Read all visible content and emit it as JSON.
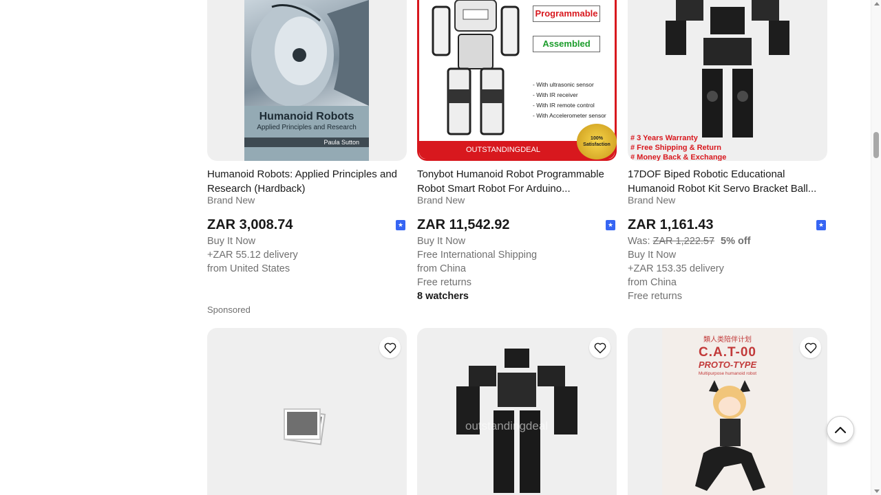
{
  "colors": {
    "text_primary": "#191919",
    "text_secondary": "#707070",
    "accent_blue": "#3665f3",
    "brand_red": "#d8181e"
  },
  "listings_row1": [
    {
      "title": "Humanoid Robots: Applied Principles and Research (Hardback)",
      "condition": "Brand New",
      "price": "ZAR 3,008.74",
      "buy_format": "Buy It Now",
      "shipping": "+ZAR 55.12 delivery",
      "location": "from United States",
      "image": {
        "book_title": "Humanoid Robots",
        "book_subtitle": "Applied Principles and Research",
        "book_author": "Paula Sutton"
      }
    },
    {
      "title": "Tonybot Humanoid Robot Programmable Robot Smart Robot For Arduino...",
      "condition": "Brand New",
      "price": "ZAR 11,542.92",
      "buy_format": "Buy It Now",
      "shipping": "Free International Shipping",
      "location": "from China",
      "returns": "Free returns",
      "watchers": "8 watchers",
      "image": {
        "tag_programmable": "Programmable",
        "tag_assembled": "Assembled",
        "features": [
          "- With ultrasonic sensor",
          "- With IR receiver",
          "- With IR remote control",
          "- With Accelerometer sensor"
        ],
        "bar_text": "OUTSTANDINGDEAL",
        "seal_text": "100% Satisfaction"
      }
    },
    {
      "title": "17DOF Biped Robotic Educational Humanoid Robot Kit Servo Bracket Ball...",
      "condition": "Brand New",
      "price": "ZAR 1,161.43",
      "was_label": "Was:",
      "was_price": "ZAR 1,222.57",
      "discount": "5% off",
      "buy_format": "Buy It Now",
      "shipping": "+ZAR 153.35 delivery",
      "location": "from China",
      "returns": "Free returns",
      "image": {
        "notes": [
          "# 3 Years Warranty",
          "# Free Shipping & Return",
          "# Money Back & Exchange"
        ]
      }
    }
  ],
  "sponsored_label": "Sponsored",
  "listings_row2": [
    {
      "image": {
        "placeholder_icon": "image-placeholder-icon"
      }
    },
    {
      "image": {
        "watermark": "outstandingdeal"
      }
    },
    {
      "image": {
        "top_text": "類人类陪伴计划",
        "title": "C.A.T-00",
        "subtitle": "PROTO-TYPE",
        "caption": "Multipurpose humanoid robot"
      }
    }
  ],
  "icons": {
    "compare": "compare-icon",
    "heart": "heart-icon",
    "back_to_top": "chevron-up-icon"
  }
}
